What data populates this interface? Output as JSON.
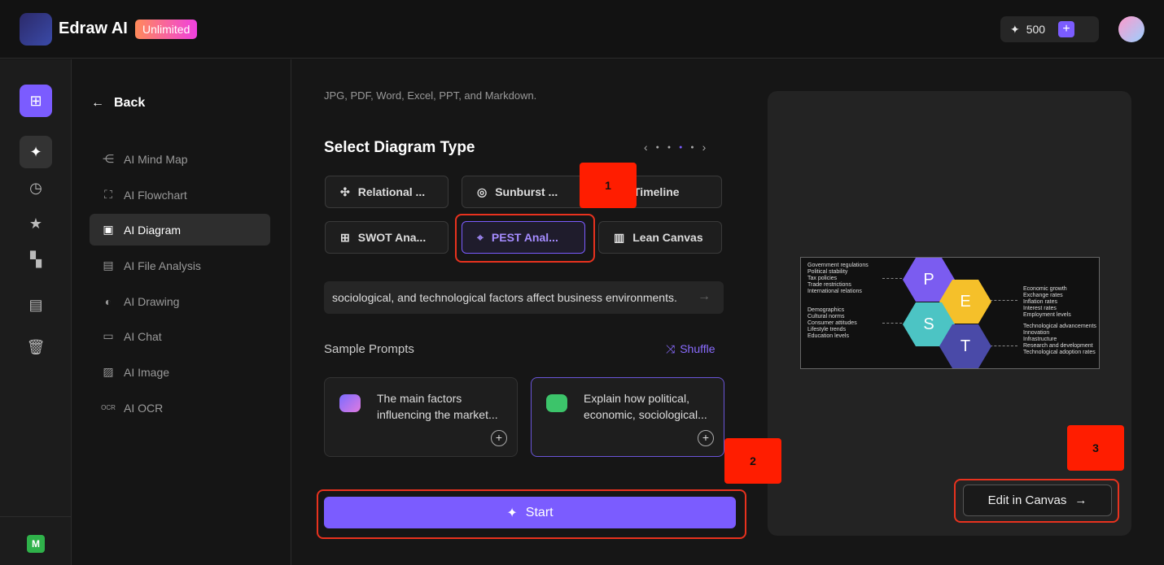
{
  "header": {
    "app_name": "Edraw AI",
    "plan_badge": "Unlimited",
    "credits": "500",
    "plus_label": "+"
  },
  "sidebar": {
    "back_label": "Back",
    "items": [
      {
        "label": "AI Mind Map",
        "icon": "mind-map-icon"
      },
      {
        "label": "AI Flowchart",
        "icon": "flowchart-icon"
      },
      {
        "label": "AI Diagram",
        "icon": "diagram-icon",
        "active": true
      },
      {
        "label": "AI File Analysis",
        "icon": "file-analysis-icon"
      },
      {
        "label": "AI Drawing",
        "icon": "palette-icon"
      },
      {
        "label": "AI Chat",
        "icon": "chat-icon"
      },
      {
        "label": "AI Image",
        "icon": "image-icon"
      },
      {
        "label": "AI OCR",
        "icon": "ocr-icon"
      }
    ]
  },
  "rail": {
    "user_initial": "M"
  },
  "main": {
    "file_types_text": "JPG, PDF, Word, Excel, PPT, and Markdown.",
    "section_title": "Select Diagram Type",
    "pager": {
      "pages": 4,
      "current": 3
    },
    "diagram_types": [
      {
        "label": "Relational ...",
        "icon": "relational-icon"
      },
      {
        "label": "Sunburst ...",
        "icon": "sunburst-icon"
      },
      {
        "label": "Timeline",
        "icon": "timeline-icon"
      },
      {
        "label": "SWOT Ana...",
        "icon": "swot-icon"
      },
      {
        "label": "PEST Anal...",
        "icon": "pest-icon",
        "selected": true
      },
      {
        "label": "Lean Canvas",
        "icon": "lean-canvas-icon"
      }
    ],
    "prompt_value": "sociological, and technological factors affect business environments.",
    "sample_prompts_label": "Sample Prompts",
    "shuffle_label": "Shuffle",
    "samples": [
      {
        "text": "The main factors influencing the market..."
      },
      {
        "text": "Explain how political, economic, sociological..."
      }
    ],
    "start_label": "Start"
  },
  "annotations": [
    "1",
    "2",
    "3"
  ],
  "preview": {
    "edit_label": "Edit in Canvas",
    "pest": {
      "P": {
        "letter": "P",
        "items": [
          "Government regulations",
          "Political stability",
          "Tax policies",
          "Trade restrictions",
          "International relations"
        ]
      },
      "E": {
        "letter": "E",
        "items": [
          "Economic growth",
          "Exchange rates",
          "Inflation rates",
          "Interest rates",
          "Employment levels"
        ]
      },
      "S": {
        "letter": "S",
        "items": [
          "Demographics",
          "Cultural norms",
          "Consumer attitudes",
          "Lifestyle trends",
          "Education levels"
        ]
      },
      "T": {
        "letter": "T",
        "items": [
          "Technological advancements",
          "Innovation",
          "Infrastructure",
          "Research and development",
          "Technological adoption rates"
        ]
      }
    }
  },
  "colors": {
    "accent": "#7b5cff",
    "annotation": "#ff1d00",
    "P": "#7b5cf0",
    "E": "#f5c02a",
    "S": "#4cc4c4",
    "T": "#4a4aa8"
  }
}
